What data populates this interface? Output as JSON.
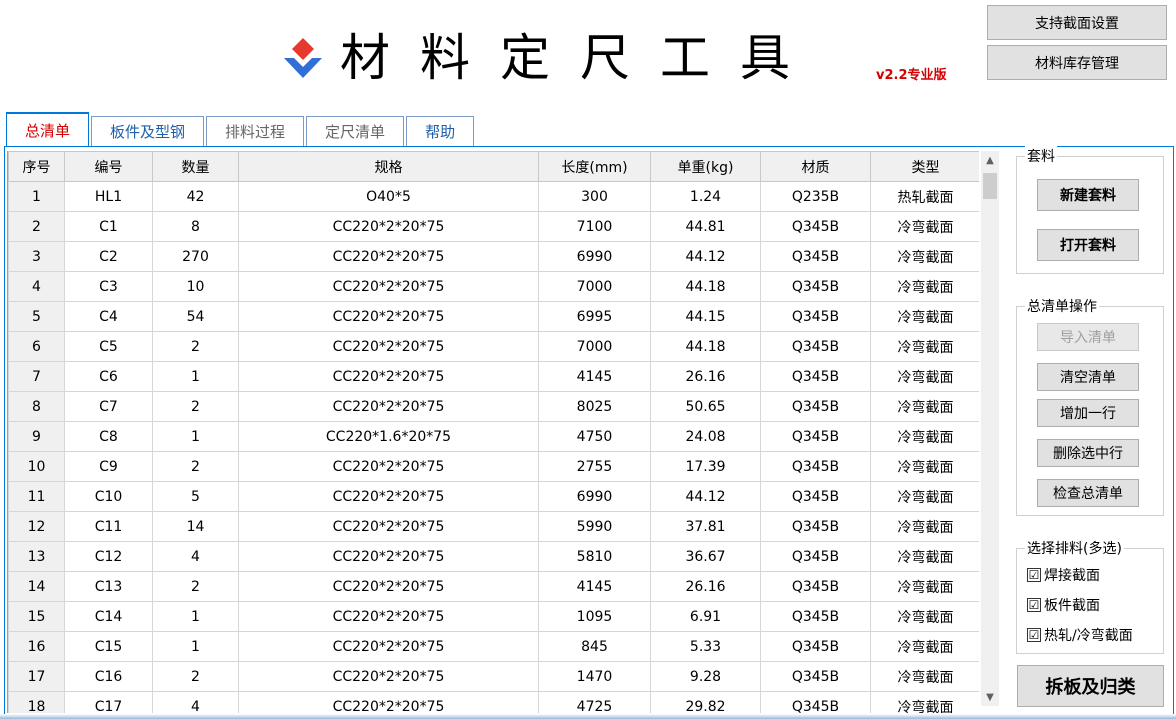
{
  "header": {
    "title": "材料定尺工具",
    "version": "v2.2专业版",
    "buttons": {
      "section_settings": "支持截面设置",
      "stock_manage": "材料库存管理"
    }
  },
  "colors": {
    "accent": "#0078d7",
    "active_tab_text": "#d40000",
    "logo_red": "#e8392f",
    "logo_blue": "#2f6fd6"
  },
  "tabs": [
    {
      "label": "总清单"
    },
    {
      "label": "板件及型钢"
    },
    {
      "label": "排料过程"
    },
    {
      "label": "定尺清单"
    },
    {
      "label": "帮助"
    }
  ],
  "table": {
    "columns": [
      "序号",
      "编号",
      "数量",
      "规格",
      "长度(mm)",
      "单重(kg)",
      "材质",
      "类型"
    ],
    "rows": [
      [
        "1",
        "HL1",
        "42",
        "O40*5",
        "300",
        "1.24",
        "Q235B",
        "热轧截面"
      ],
      [
        "2",
        "C1",
        "8",
        "CC220*2*20*75",
        "7100",
        "44.81",
        "Q345B",
        "冷弯截面"
      ],
      [
        "3",
        "C2",
        "270",
        "CC220*2*20*75",
        "6990",
        "44.12",
        "Q345B",
        "冷弯截面"
      ],
      [
        "4",
        "C3",
        "10",
        "CC220*2*20*75",
        "7000",
        "44.18",
        "Q345B",
        "冷弯截面"
      ],
      [
        "5",
        "C4",
        "54",
        "CC220*2*20*75",
        "6995",
        "44.15",
        "Q345B",
        "冷弯截面"
      ],
      [
        "6",
        "C5",
        "2",
        "CC220*2*20*75",
        "7000",
        "44.18",
        "Q345B",
        "冷弯截面"
      ],
      [
        "7",
        "C6",
        "1",
        "CC220*2*20*75",
        "4145",
        "26.16",
        "Q345B",
        "冷弯截面"
      ],
      [
        "8",
        "C7",
        "2",
        "CC220*2*20*75",
        "8025",
        "50.65",
        "Q345B",
        "冷弯截面"
      ],
      [
        "9",
        "C8",
        "1",
        "CC220*1.6*20*75",
        "4750",
        "24.08",
        "Q345B",
        "冷弯截面"
      ],
      [
        "10",
        "C9",
        "2",
        "CC220*2*20*75",
        "2755",
        "17.39",
        "Q345B",
        "冷弯截面"
      ],
      [
        "11",
        "C10",
        "5",
        "CC220*2*20*75",
        "6990",
        "44.12",
        "Q345B",
        "冷弯截面"
      ],
      [
        "12",
        "C11",
        "14",
        "CC220*2*20*75",
        "5990",
        "37.81",
        "Q345B",
        "冷弯截面"
      ],
      [
        "13",
        "C12",
        "4",
        "CC220*2*20*75",
        "5810",
        "36.67",
        "Q345B",
        "冷弯截面"
      ],
      [
        "14",
        "C13",
        "2",
        "CC220*2*20*75",
        "4145",
        "26.16",
        "Q345B",
        "冷弯截面"
      ],
      [
        "15",
        "C14",
        "1",
        "CC220*2*20*75",
        "1095",
        "6.91",
        "Q345B",
        "冷弯截面"
      ],
      [
        "16",
        "C15",
        "1",
        "CC220*2*20*75",
        "845",
        "5.33",
        "Q345B",
        "冷弯截面"
      ],
      [
        "17",
        "C16",
        "2",
        "CC220*2*20*75",
        "1470",
        "9.28",
        "Q345B",
        "冷弯截面"
      ],
      [
        "18",
        "C17",
        "4",
        "CC220*2*20*75",
        "4725",
        "29.82",
        "Q345B",
        "冷弯截面"
      ]
    ]
  },
  "panel": {
    "nesting": {
      "title": "套料",
      "new_btn": "新建套料",
      "open_btn": "打开套料"
    },
    "ops": {
      "title": "总清单操作",
      "import_btn": "导入清单",
      "clear_btn": "清空清单",
      "add_row_btn": "增加一行",
      "delete_btn": "删除选中行",
      "check_btn": "检查总清单"
    },
    "select": {
      "title": "选择排料(多选)",
      "options": [
        {
          "label": "焊接截面",
          "checked": "☑"
        },
        {
          "label": "板件截面",
          "checked": "☑"
        },
        {
          "label": "热轧/冷弯截面",
          "checked": "☑"
        }
      ]
    },
    "split_btn": "拆板及归类"
  },
  "scrollbar": {
    "up_icon": "▲",
    "down_icon": "▼"
  }
}
